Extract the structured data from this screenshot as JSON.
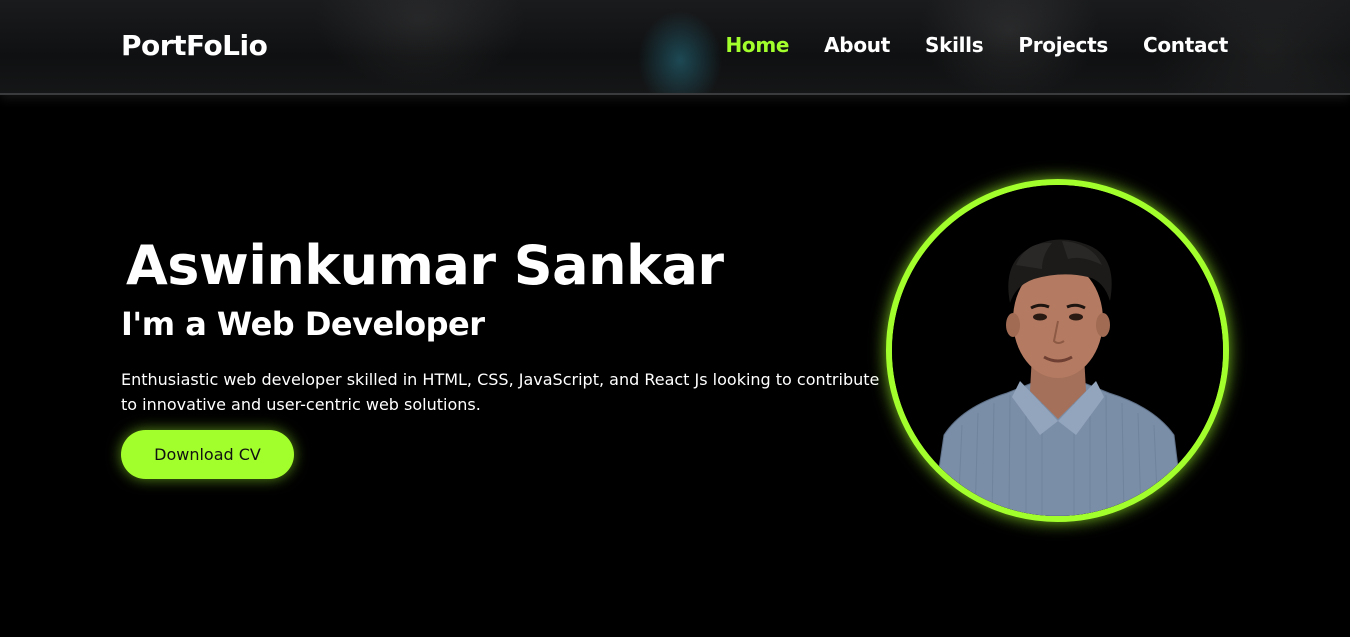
{
  "header": {
    "logo": "PortFoLio",
    "nav": [
      {
        "label": "Home",
        "active": true
      },
      {
        "label": "About",
        "active": false
      },
      {
        "label": "Skills",
        "active": false
      },
      {
        "label": "Projects",
        "active": false
      },
      {
        "label": "Contact",
        "active": false
      }
    ]
  },
  "hero": {
    "name": "Aswinkumar Sankar",
    "role": "I'm a Web Developer",
    "description": "Enthusiastic web developer skilled in HTML, CSS, JavaScript, and React Js looking to contribute to innovative and user-centric web solutions.",
    "cta_label": "Download CV"
  },
  "theme": {
    "accent": "#a3ff2c",
    "background": "#000000",
    "text": "#ffffff"
  }
}
